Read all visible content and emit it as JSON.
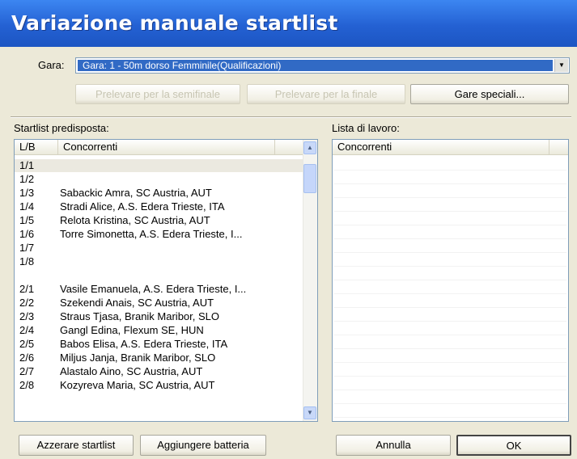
{
  "window": {
    "title": "Variazione manuale startlist"
  },
  "gara": {
    "label": "Gara:",
    "selected": "Gara: 1 - 50m dorso Femminile(Qualificazioni)"
  },
  "top_buttons": {
    "semifinale": "Prelevare per la semifinale",
    "finale": "Prelevare per la finale",
    "speciali": "Gare speciali..."
  },
  "startlist": {
    "label": "Startlist predisposta:",
    "col_lb": "L/B",
    "col_concorrenti": "Concorrenti",
    "rows": [
      {
        "lb": "1/1",
        "name": ""
      },
      {
        "lb": "1/2",
        "name": ""
      },
      {
        "lb": "1/3",
        "name": "Sabackic Amra, SC Austria, AUT"
      },
      {
        "lb": "1/4",
        "name": "Stradi Alice, A.S. Edera Trieste, ITA"
      },
      {
        "lb": "1/5",
        "name": "Relota Kristina, SC Austria, AUT"
      },
      {
        "lb": "1/6",
        "name": "Torre Simonetta, A.S. Edera Trieste, I..."
      },
      {
        "lb": "1/7",
        "name": ""
      },
      {
        "lb": "1/8",
        "name": ""
      },
      {
        "lb": "",
        "name": ""
      },
      {
        "lb": "2/1",
        "name": "Vasile Emanuela, A.S. Edera Trieste, I..."
      },
      {
        "lb": "2/2",
        "name": "Szekendi Anais, SC Austria, AUT"
      },
      {
        "lb": "2/3",
        "name": "Straus Tjasa, Branik Maribor, SLO"
      },
      {
        "lb": "2/4",
        "name": "Gangl Edina, Flexum SE, HUN"
      },
      {
        "lb": "2/5",
        "name": "Babos Elisa, A.S. Edera Trieste, ITA"
      },
      {
        "lb": "2/6",
        "name": "Miljus Janja, Branik Maribor, SLO"
      },
      {
        "lb": "2/7",
        "name": "Alastalo Aino, SC Austria, AUT"
      },
      {
        "lb": "2/8",
        "name": "Kozyreva Maria, SC Austria, AUT"
      }
    ]
  },
  "lavoro": {
    "label": "Lista di lavoro:",
    "col_concorrenti": "Concorrenti"
  },
  "bottom_buttons": {
    "azzerare": "Azzerare startlist",
    "aggiungere": "Aggiungere batteria",
    "annulla": "Annulla",
    "ok": "OK"
  }
}
